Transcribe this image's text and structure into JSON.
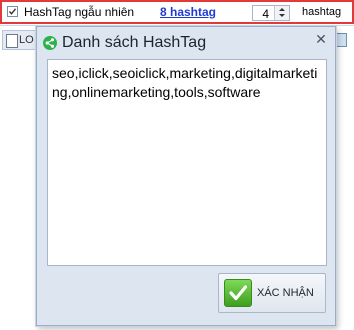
{
  "toolbar": {
    "random_hashtag_label": "HashTag ngẫu nhiên",
    "random_hashtag_checked": true,
    "hashtag_count_link": "8 hashtag",
    "stepper_value": "4",
    "unit_label": "hashtag"
  },
  "background": {
    "tab_label": "LO"
  },
  "dialog": {
    "title": "Danh sách HashTag",
    "close_glyph": "✕",
    "tags_text": "seo,iclick,seoiclick,marketing,digitalmarketing,onlinemarketing,tools,software",
    "confirm_label": "XÁC NHẬN"
  },
  "colors": {
    "highlight_border": "#e23a3a",
    "link": "#1f3bd6",
    "dialog_bg": "#dde6f0",
    "confirm_icon": "#3e9e1f"
  }
}
